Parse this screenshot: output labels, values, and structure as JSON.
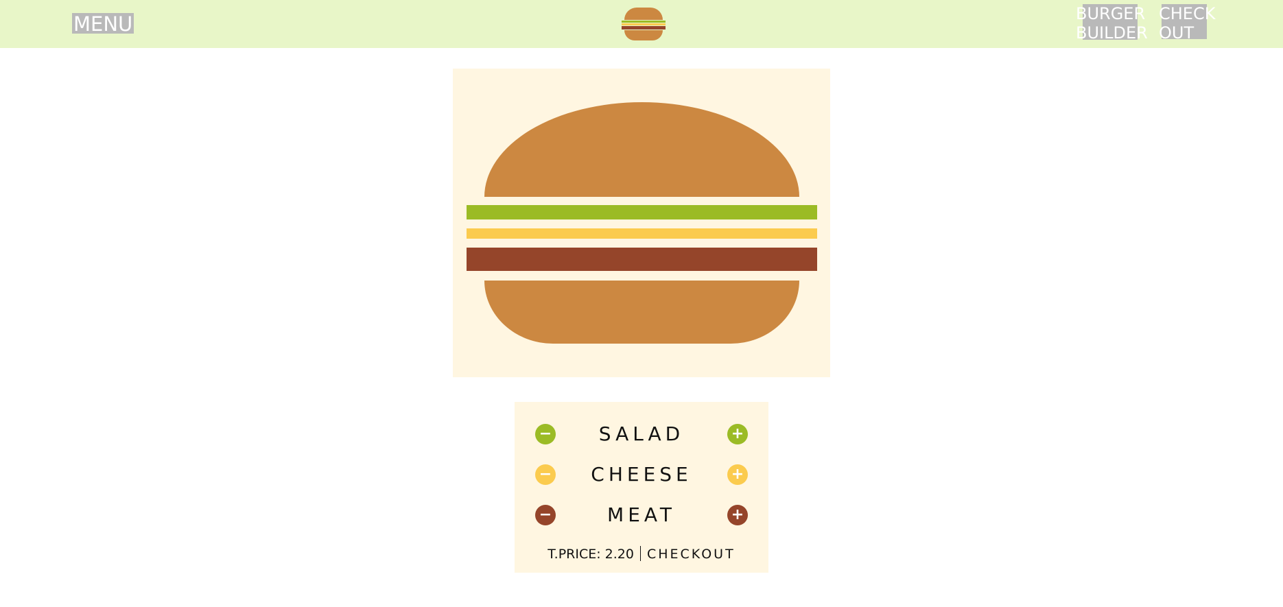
{
  "header": {
    "menu_label": "MENU",
    "nav": {
      "builder_line1": "BURGER",
      "builder_line2": "BUILDER",
      "checkout_line1": "CHECK",
      "checkout_line2": "OUT"
    },
    "logo_icon": "burger-logo-icon"
  },
  "ingredients": [
    {
      "label": "SALAD",
      "color": "#9bbb25",
      "minus": "−",
      "plus": "+"
    },
    {
      "label": "CHEESE",
      "color": "#fbcb4e",
      "minus": "−",
      "plus": "+"
    },
    {
      "label": "MEAT",
      "color": "#95452a",
      "minus": "−",
      "plus": "+"
    }
  ],
  "colors": {
    "header_bg": "#e8f6c8",
    "panel_bg": "#fff6e1",
    "bun": "#cc8841",
    "salad": "#9bbb25",
    "cheese": "#fbcb4e",
    "meat": "#95452a"
  },
  "summary": {
    "price_text": "T.PRICE: 2.20",
    "checkout_label": "CHECKOUT"
  }
}
